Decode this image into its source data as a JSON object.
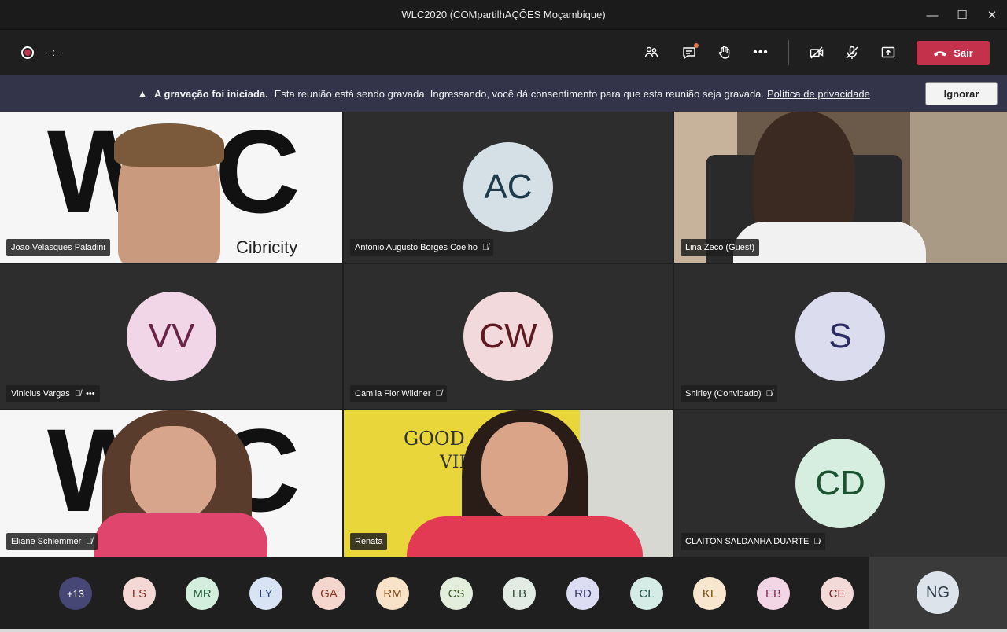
{
  "window": {
    "title": "WLC2020 (COMpartilhAÇÕES Moçambique)",
    "controls": [
      "—",
      "☐",
      "✕"
    ]
  },
  "toolbar": {
    "timer": "--:--",
    "leave_label": "Sair",
    "more_label": "•••"
  },
  "banner": {
    "strong": "A gravação foi iniciada.",
    "text": "Esta reunião está sendo gravada. Ingressando, você dá consentimento para que esta reunião seja gravada.",
    "link": "Política de privacidade",
    "ignore_label": "Ignorar"
  },
  "tiles": [
    {
      "name": "Joao Velasques Paladini",
      "type": "video"
    },
    {
      "name": "Antonio Augusto Borges Coelho",
      "initials": "AC",
      "bg": "#d5e0e6",
      "fg": "#1f3a4a",
      "muted": true
    },
    {
      "name": "Lina Zeco (Guest)",
      "type": "video"
    },
    {
      "name": "Vinicius Vargas",
      "initials": "VV",
      "bg": "#f0d6e6",
      "fg": "#6a2448",
      "muted": true,
      "more": "•••"
    },
    {
      "name": "Camila Flor Wildner",
      "initials": "CW",
      "bg": "#f2d9db",
      "fg": "#5e1a22",
      "muted": true
    },
    {
      "name": "Shirley (Convidado)",
      "initials": "S",
      "bg": "#dcdcef",
      "fg": "#2c2d62",
      "muted": true
    },
    {
      "name": "Eliane Schlemmer",
      "type": "video",
      "muted": true
    },
    {
      "name": "Renata",
      "type": "video"
    },
    {
      "name": "CLAITON SALDANHA DUARTE",
      "initials": "CD",
      "bg": "#d6eedf",
      "fg": "#1b5331",
      "muted": true
    }
  ],
  "video_text": {
    "logo": "WLC",
    "cibricity": "Cibricity",
    "good": "GOOD",
    "vib": "VIB"
  },
  "strip": [
    {
      "initials": "+13",
      "bg": "#464775",
      "fg": "#ffffff"
    },
    {
      "initials": "LS",
      "bg": "#f4d8d6",
      "fg": "#8a2b28"
    },
    {
      "initials": "MR",
      "bg": "#d4eedd",
      "fg": "#1e5a36"
    },
    {
      "initials": "LY",
      "bg": "#d8e3f3",
      "fg": "#24406b"
    },
    {
      "initials": "GA",
      "bg": "#f5d6cf",
      "fg": "#8a3321"
    },
    {
      "initials": "RM",
      "bg": "#f8e2c8",
      "fg": "#7a4a14"
    },
    {
      "initials": "CS",
      "bg": "#e3efdc",
      "fg": "#3a5a26"
    },
    {
      "initials": "LB",
      "bg": "#e2ebe4",
      "fg": "#2e4a36"
    },
    {
      "initials": "RD",
      "bg": "#dcdcf2",
      "fg": "#33346a"
    },
    {
      "initials": "CL",
      "bg": "#d5ece6",
      "fg": "#1d5246"
    },
    {
      "initials": "KL",
      "bg": "#f8e6cf",
      "fg": "#7a5014"
    },
    {
      "initials": "EB",
      "bg": "#f3d6e6",
      "fg": "#7a244e"
    },
    {
      "initials": "CE",
      "bg": "#f2dad9",
      "fg": "#6e2224"
    }
  ],
  "self": {
    "initials": "NG"
  },
  "icons": {
    "record": "record-icon",
    "participants": "people-icon",
    "chat": "chat-icon",
    "hand": "raise-hand-icon",
    "more": "more-icon",
    "camera": "camera-off-icon",
    "mic": "mic-off-icon",
    "share": "share-icon",
    "phone": "phone-icon",
    "warning": "warning-icon"
  },
  "colors": {
    "leave": "#c4314b",
    "banner": "#33344a",
    "notify": "#e97548"
  }
}
